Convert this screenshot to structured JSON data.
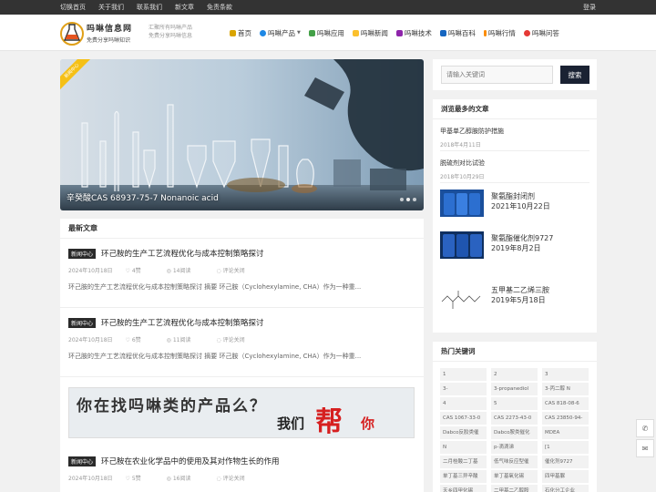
{
  "topbar": {
    "links": [
      "切换首页",
      "关于我们",
      "联系我们",
      "新文章",
      "免责条款"
    ],
    "login": "登录"
  },
  "header": {
    "logo_title": "吗啉信息网",
    "logo_subtitle": "免费分享吗啉知识",
    "slogan_line1": "汇聚所有吗啉产品",
    "slogan_line2": "免费分享吗啉信息",
    "nav": [
      {
        "label": "首页",
        "icon": "home-icon",
        "color": "#d9a400"
      },
      {
        "label": "吗啉产品",
        "icon": "globe-icon",
        "color": "#1e88e5",
        "dropdown": true
      },
      {
        "label": "吗啉应用",
        "icon": "app-icon",
        "color": "#43a047"
      },
      {
        "label": "吗啉新闻",
        "icon": "news-icon",
        "color": "#fbc02d"
      },
      {
        "label": "吗啉技术",
        "icon": "grad-cap-icon",
        "color": "#8e24aa"
      },
      {
        "label": "吗啉百科",
        "icon": "book-icon",
        "color": "#1565c0"
      },
      {
        "label": "吗啉行情",
        "icon": "trend-icon",
        "color": "#fb8c00"
      },
      {
        "label": "吗啉问答",
        "icon": "question-icon",
        "color": "#e53935"
      }
    ]
  },
  "slider": {
    "badge": "新闻中心",
    "caption": "辛癸酸CAS 68937-75-7  Nonanoic acid"
  },
  "latest": {
    "heading": "最新文章",
    "articles": [
      {
        "tag": "新闻中心",
        "title": "环己胺的生产工艺流程优化与成本控制策略探讨",
        "date": "2024年10月18日",
        "likes": "4赞",
        "views": "14阅读",
        "comments": "评论关闭",
        "excerpt": "环己胺的生产工艺流程优化与成本控制策略探讨 摘要 环己胺（Cyclohexylamine, CHA）作为一种重..."
      },
      {
        "tag": "新闻中心",
        "title": "环己胺的生产工艺流程优化与成本控制策略探讨",
        "date": "2024年10月18日",
        "likes": "6赞",
        "views": "11阅读",
        "comments": "评论关闭",
        "excerpt": "环己胺的生产工艺流程优化与成本控制策略探讨 摘要 环己胺（Cyclohexylamine, CHA）作为一种重..."
      },
      {
        "tag": "新闻中心",
        "title": "环己胺在农业化学品中的使用及其对作物生长的作用",
        "date": "2024年10月18日",
        "likes": "5赞",
        "views": "16阅读",
        "comments": "评论关闭",
        "excerpt": ""
      }
    ]
  },
  "banner": {
    "line1": "你在找吗啉类的产品么？",
    "line2": "我们",
    "line3": "帮",
    "line4": "你"
  },
  "search": {
    "placeholder": "请输入关键词",
    "button": "搜索"
  },
  "popular": {
    "heading": "浏览最多的文章",
    "items": [
      {
        "title": "甲基单乙醇胺防护措施",
        "date": "2018年4月11日"
      },
      {
        "title": "脱硫剂对比试验",
        "date": "2018年10月29日"
      },
      {
        "title": "聚氨酯封闭剂",
        "date": "2021年10月22日"
      },
      {
        "title": "聚氨酯催化剂9727",
        "date": "2019年8月2日"
      },
      {
        "title": "五甲基二乙烯三胺",
        "date": "2019年5月18日"
      }
    ]
  },
  "keywords": {
    "heading": "热门关键词",
    "items": [
      "1",
      "2",
      "3",
      "3-",
      "3-propanediol",
      "3-丙二醇 N",
      "4",
      "5",
      "CAS 818-08-6",
      "CAS 1067-33-0",
      "CAS 2273-43-0",
      "CAS 23850-94-",
      "Dabco反胶类催",
      "Dabco胺类催化",
      "MDEA",
      "N",
      "p-滴滴涕",
      "[1",
      "二月桂酸二丁基",
      "低气味反应型催",
      "催化剂9727",
      "单丁基三异辛酸",
      "单丁基氧化锡",
      "四甲基脲",
      "天乡四甲化锡",
      "二甲基二乙醇胺",
      "石化分工企业"
    ]
  },
  "float_tools": [
    "phone-icon",
    "wechat-icon"
  ]
}
